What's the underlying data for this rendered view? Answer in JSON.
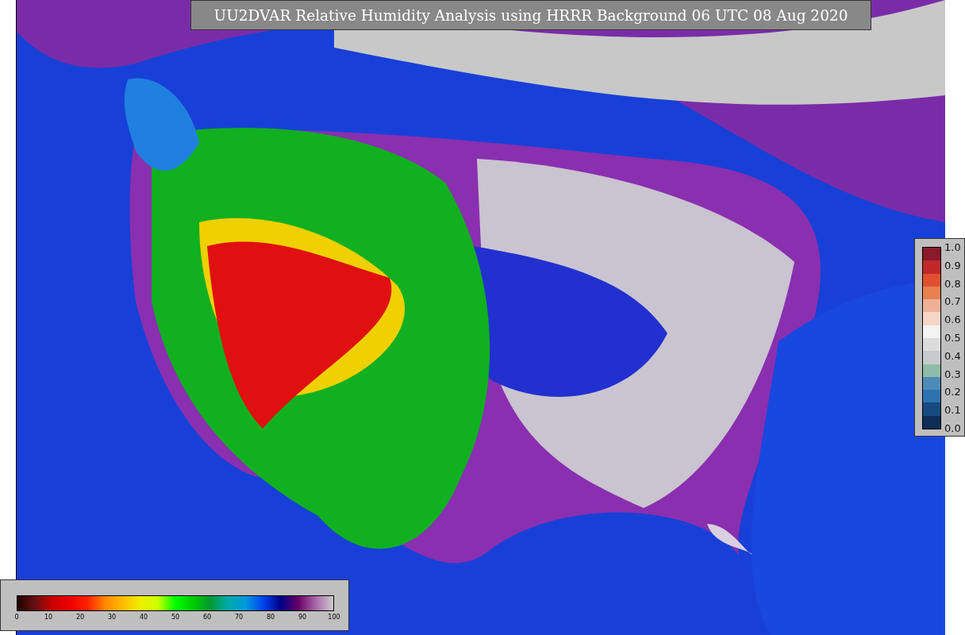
{
  "title": "UU2DVAR Relative Humidity Analysis using HRRR Background 06 UTC 08 Aug 2020",
  "humidity_colorbar": {
    "ticks": [
      "0",
      "10",
      "20",
      "30",
      "40",
      "50",
      "60",
      "70",
      "80",
      "90",
      "100"
    ]
  },
  "fraction_colorbar": {
    "ticks": [
      "1.0",
      "0.9",
      "0.8",
      "0.7",
      "0.6",
      "0.5",
      "0.4",
      "0.3",
      "0.2",
      "0.1",
      "0.0"
    ]
  }
}
